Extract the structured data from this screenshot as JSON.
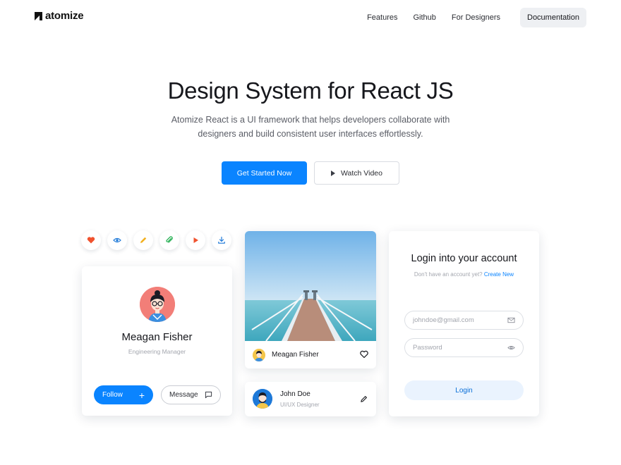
{
  "nav": {
    "logo": "atomize",
    "links": [
      "Features",
      "Github",
      "For Designers"
    ],
    "documentation": "Documentation"
  },
  "hero": {
    "title": "Design System for React JS",
    "subtitle_line1": "Atomize React is a UI framework that helps developers collaborate with",
    "subtitle_line2": "designers and build consistent user interfaces effortlessly.",
    "primary_cta": "Get Started Now",
    "secondary_cta": "Watch Video"
  },
  "icon_buttons": [
    {
      "name": "heart-icon",
      "color": "#f0522e"
    },
    {
      "name": "eye-icon",
      "color": "#1e79d8"
    },
    {
      "name": "pencil-icon",
      "color": "#f2b01e"
    },
    {
      "name": "attachment-icon",
      "color": "#2fb35a"
    },
    {
      "name": "play-icon",
      "color": "#f0522e"
    },
    {
      "name": "download-icon",
      "color": "#1e79d8"
    }
  ],
  "profile_card": {
    "name": "Meagan Fisher",
    "role": "Engineering Manager",
    "follow": "Follow",
    "message": "Message"
  },
  "photo_card": {
    "name": "Meagan Fisher"
  },
  "user_card": {
    "name": "John Doe",
    "role": "UI/UX Designer"
  },
  "login_card": {
    "title": "Login into your account",
    "prompt": "Don't have an account yet?",
    "create_link": "Create New",
    "email_placeholder": "johndoe@gmail.com",
    "password_placeholder": "Password",
    "login_button": "Login"
  },
  "colors": {
    "primary": "#0a84ff",
    "text": "#16171c",
    "muted": "#a3a6ae"
  }
}
